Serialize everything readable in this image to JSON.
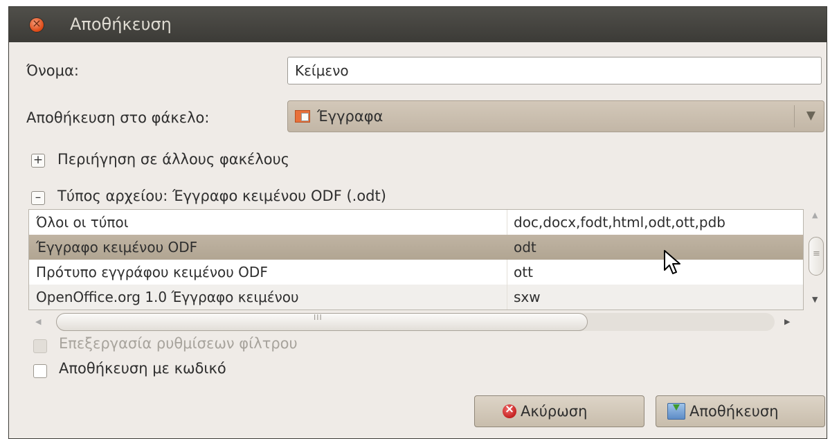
{
  "window": {
    "title": "Αποθήκευση"
  },
  "name_field": {
    "label": "Όνομα:",
    "value": "Κείμενο"
  },
  "folder": {
    "label": "Αποθήκευση στο φάκελο:",
    "value": "Έγγραφα"
  },
  "browse_expander": {
    "symbol": "+",
    "label": "Περιήγηση σε άλλους φακέλους"
  },
  "filetype_expander": {
    "symbol": "–",
    "label": "Τύπος αρχείου: Έγγραφο κειμένου ODF (.odt)"
  },
  "filetypes": {
    "rows": [
      {
        "name": "Όλοι οι τύποι",
        "ext": "doc,docx,fodt,html,odt,ott,pdb"
      },
      {
        "name": "Έγγραφο κειμένου ODF",
        "ext": "odt",
        "selected": true
      },
      {
        "name": "Πρότυπο εγγράφου κειμένου ODF",
        "ext": "ott"
      },
      {
        "name": "OpenOffice.org 1.0 Έγγραφο κειμένου",
        "ext": "sxw"
      }
    ],
    "scroll_up": "▲",
    "scroll_down": "▼",
    "scroll_left": "◀",
    "scroll_right": "▶",
    "hgrip": "III",
    "vgrip": "≡"
  },
  "options": {
    "edit_filter_settings": {
      "label": "Επεξεργασία ρυθμίσεων φίλτρου",
      "checked": false,
      "disabled": true
    },
    "save_with_password": {
      "label": "Αποθήκευση με κωδικό",
      "checked": false
    }
  },
  "buttons": {
    "cancel": "Ακύρωση",
    "save": "Αποθήκευση"
  },
  "icons": {
    "close": "close-icon",
    "folder": "documents-folder-icon",
    "dropdown": "▼",
    "cancel": "cancel-icon",
    "save": "save-icon",
    "cursor": "mouse-cursor-icon"
  },
  "colors": {
    "titlebar": "#3c3b37",
    "window_bg": "#efebe7",
    "selection": "#b7ab99",
    "close_button": "#dd4814"
  }
}
